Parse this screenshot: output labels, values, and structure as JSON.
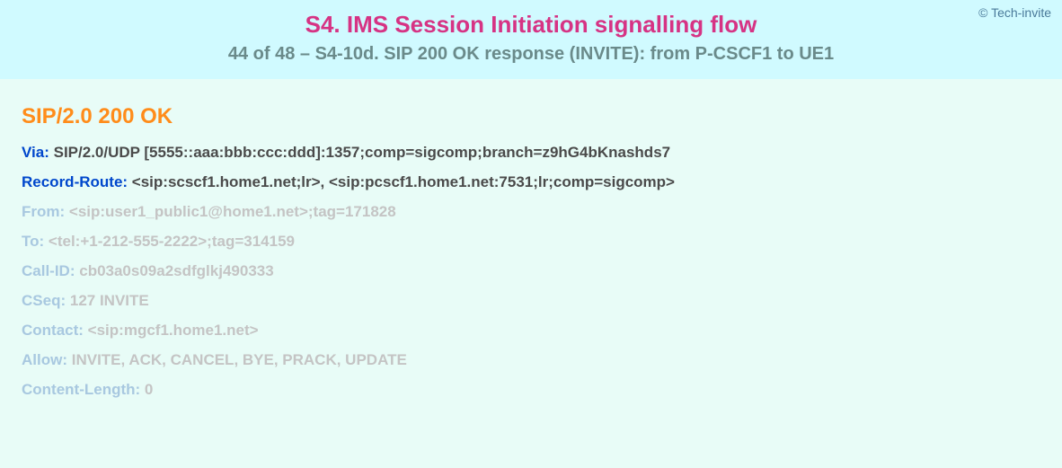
{
  "copyright": "© Tech-invite",
  "title": "S4. IMS Session Initiation signalling flow",
  "subtitle": "44 of 48 – S4-10d. SIP 200 OK response (INVITE): from P-CSCF1 to UE1",
  "sip_status": "SIP/2.0 200 OK",
  "headers": [
    {
      "label": "Via",
      "value": "SIP/2.0/UDP [5555::aaa:bbb:ccc:ddd]:1357;comp=sigcomp;branch=z9hG4bKnashds7",
      "style": "primary"
    },
    {
      "label": "Record-Route",
      "value": "<sip:scscf1.home1.net;lr>, <sip:pcscf1.home1.net:7531;lr;comp=sigcomp>",
      "style": "primary"
    },
    {
      "label": "From",
      "value": "<sip:user1_public1@home1.net>;tag=171828",
      "style": "dim"
    },
    {
      "label": "To",
      "value": "<tel:+1-212-555-2222>;tag=314159",
      "style": "dim"
    },
    {
      "label": "Call-ID",
      "value": "cb03a0s09a2sdfglkj490333",
      "style": "dim"
    },
    {
      "label": "CSeq",
      "value": "127 INVITE",
      "style": "dim"
    },
    {
      "label": "Contact",
      "value": "<sip:mgcf1.home1.net>",
      "style": "dim"
    },
    {
      "label": "Allow",
      "value": "INVITE, ACK, CANCEL, BYE, PRACK, UPDATE",
      "style": "dim"
    },
    {
      "label": "Content-Length",
      "value": "0",
      "style": "dim"
    }
  ]
}
